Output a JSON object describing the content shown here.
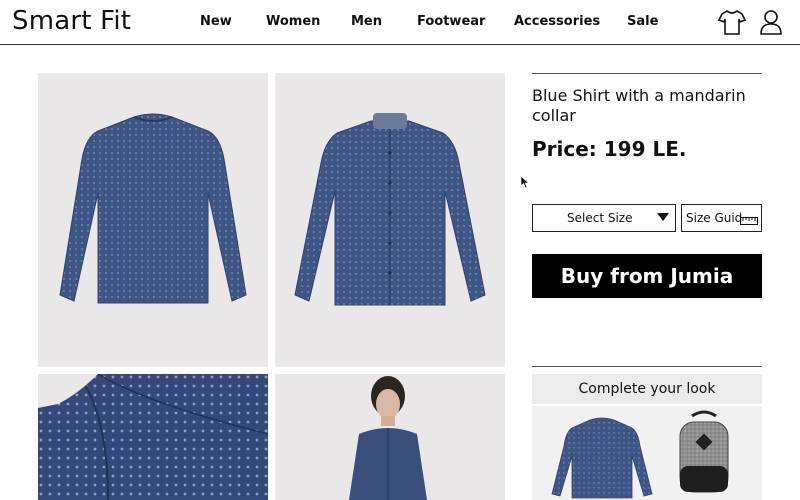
{
  "header": {
    "logo": "Smart Fit",
    "nav": [
      "New",
      "Women",
      "Men",
      "Footwear",
      "Accessories",
      "Sale"
    ]
  },
  "icons": {
    "cart": "tshirt-icon",
    "account": "user-icon",
    "ruler": "ruler-icon",
    "caret": "caret-down-icon"
  },
  "product": {
    "title": "Blue Shirt with a mandarin collar",
    "price": "Price: 199 LE.",
    "size_select": "Select Size",
    "size_guide": "Size Guid",
    "buy_label": "Buy from Jumia"
  },
  "complete_look": {
    "title": "Complete your look"
  },
  "colors": {
    "shirt": "#3e5585",
    "tile_bg": "#e9e7e8",
    "buy_bg": "#000000"
  }
}
